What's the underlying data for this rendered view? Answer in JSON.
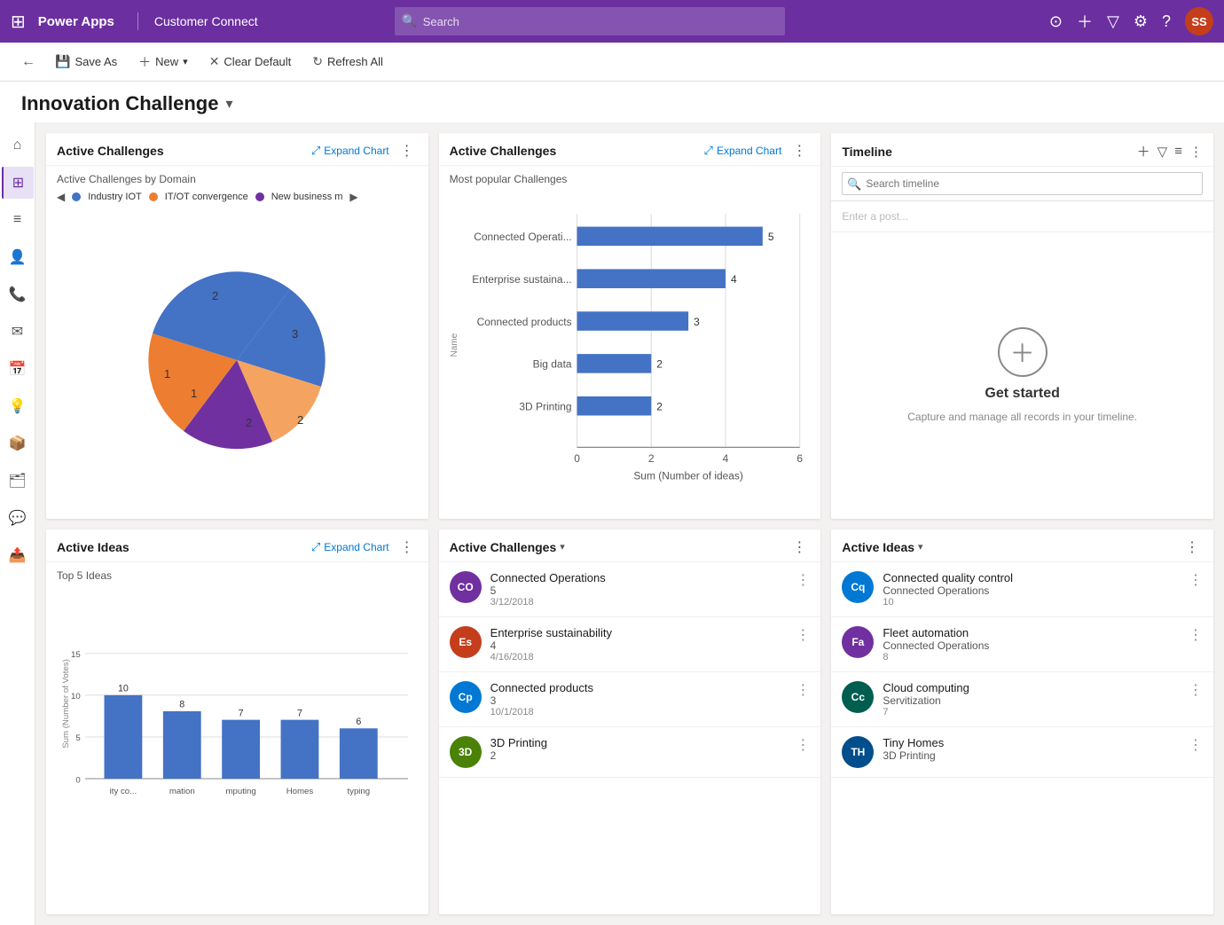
{
  "topnav": {
    "app_name": "Power Apps",
    "divider": "|",
    "env_name": "Customer Connect",
    "search_placeholder": "Search",
    "avatar_initials": "SS"
  },
  "toolbar": {
    "back_label": "←",
    "save_as_label": "Save As",
    "new_label": "New",
    "clear_default_label": "Clear Default",
    "refresh_all_label": "Refresh All"
  },
  "page_title": "Innovation Challenge",
  "sidebar": {
    "items": [
      {
        "icon": "⊞",
        "name": "grid-icon",
        "active": false
      },
      {
        "icon": "⌂",
        "name": "home-icon",
        "active": false
      },
      {
        "icon": "⊞",
        "name": "dashboard-icon",
        "active": true
      },
      {
        "icon": "☰",
        "name": "list-icon",
        "active": false
      },
      {
        "icon": "👤",
        "name": "person-icon",
        "active": false
      },
      {
        "icon": "☎",
        "name": "phone-icon",
        "active": false
      },
      {
        "icon": "✉",
        "name": "mail-icon",
        "active": false
      },
      {
        "icon": "📅",
        "name": "calendar-icon",
        "active": false
      },
      {
        "icon": "💡",
        "name": "ideas-icon",
        "active": false
      },
      {
        "icon": "📦",
        "name": "products-icon",
        "active": false
      },
      {
        "icon": "🗂",
        "name": "files-icon",
        "active": false
      },
      {
        "icon": "💬",
        "name": "chat-icon",
        "active": false
      },
      {
        "icon": "📤",
        "name": "share-icon",
        "active": false
      }
    ]
  },
  "chart_active_challenges_pie": {
    "title": "Active Challenges",
    "expand_label": "Expand Chart",
    "subtitle": "Active Challenges by Domain",
    "legend": [
      {
        "label": "Industry IOT",
        "color": "#4472c4"
      },
      {
        "label": "IT/OT convergence",
        "color": "#ed7d31"
      },
      {
        "label": "New business m",
        "color": "#7030a0"
      }
    ],
    "slices": [
      {
        "value": 3,
        "color": "#4472c4",
        "label": "3"
      },
      {
        "value": 1,
        "color": "#ed7d31",
        "label": "1"
      },
      {
        "value": 2,
        "color": "#f4a460",
        "label": "2"
      },
      {
        "value": 2,
        "color": "#7030a0",
        "label": "2"
      },
      {
        "value": 1,
        "color": "#70ad47",
        "label": "1"
      }
    ],
    "labels": [
      "1",
      "2",
      "3",
      "2",
      "1"
    ]
  },
  "chart_active_challenges_bar": {
    "title": "Active Challenges",
    "expand_label": "Expand Chart",
    "subtitle": "Most popular Challenges",
    "x_label": "Sum (Number of ideas)",
    "y_label": "Name",
    "bars": [
      {
        "label": "Connected Operati...",
        "value": 5,
        "max": 6
      },
      {
        "label": "Enterprise sustaina...",
        "value": 4,
        "max": 6
      },
      {
        "label": "Connected products",
        "value": 3,
        "max": 6
      },
      {
        "label": "Big data",
        "value": 2,
        "max": 6
      },
      {
        "label": "3D Printing",
        "value": 2,
        "max": 6
      }
    ],
    "x_ticks": [
      "0",
      "2",
      "4",
      "6"
    ]
  },
  "timeline": {
    "title": "Timeline",
    "search_placeholder": "Search timeline",
    "post_placeholder": "Enter a post...",
    "get_started_title": "Get started",
    "get_started_sub": "Capture and manage all records in your timeline."
  },
  "active_ideas_bar": {
    "title": "Active Ideas",
    "expand_label": "Expand Chart",
    "subtitle": "Top 5 Ideas",
    "y_label": "Sum (Number of Votes)",
    "bars": [
      {
        "label": "ity co...",
        "value": 10
      },
      {
        "label": "mation",
        "value": 8
      },
      {
        "label": "mputing",
        "value": 7
      },
      {
        "label": "Homes",
        "value": 7
      },
      {
        "label": "typing",
        "value": 6
      }
    ],
    "y_ticks": [
      "0",
      "5",
      "10",
      "15"
    ]
  },
  "active_challenges_list": {
    "title": "Active Challenges",
    "dropdown_label": "Active Challenges",
    "items": [
      {
        "initials": "CO",
        "color": "#7030a0",
        "name": "Connected Operations",
        "count": "5",
        "date": "3/12/2018"
      },
      {
        "initials": "Es",
        "color": "#c43e1c",
        "name": "Enterprise sustainability",
        "count": "4",
        "date": "4/16/2018"
      },
      {
        "initials": "Cp",
        "color": "#0078d4",
        "name": "Connected products",
        "count": "3",
        "date": "10/1/2018"
      },
      {
        "initials": "3D",
        "color": "#498205",
        "name": "3D Printing",
        "count": "2",
        "date": ""
      }
    ]
  },
  "active_ideas_list": {
    "title": "Active Ideas",
    "items": [
      {
        "initials": "Cq",
        "color": "#0078d4",
        "name": "Connected quality control",
        "sub": "Connected Operations",
        "count": "10"
      },
      {
        "initials": "Fa",
        "color": "#7030a0",
        "name": "Fleet automation",
        "sub": "Connected Operations",
        "count": "8"
      },
      {
        "initials": "Cc",
        "color": "#005e50",
        "name": "Cloud computing",
        "sub": "Servitization",
        "count": "7"
      },
      {
        "initials": "TH",
        "color": "#004e8c",
        "name": "Tiny Homes",
        "sub": "3D Printing",
        "count": ""
      }
    ]
  }
}
